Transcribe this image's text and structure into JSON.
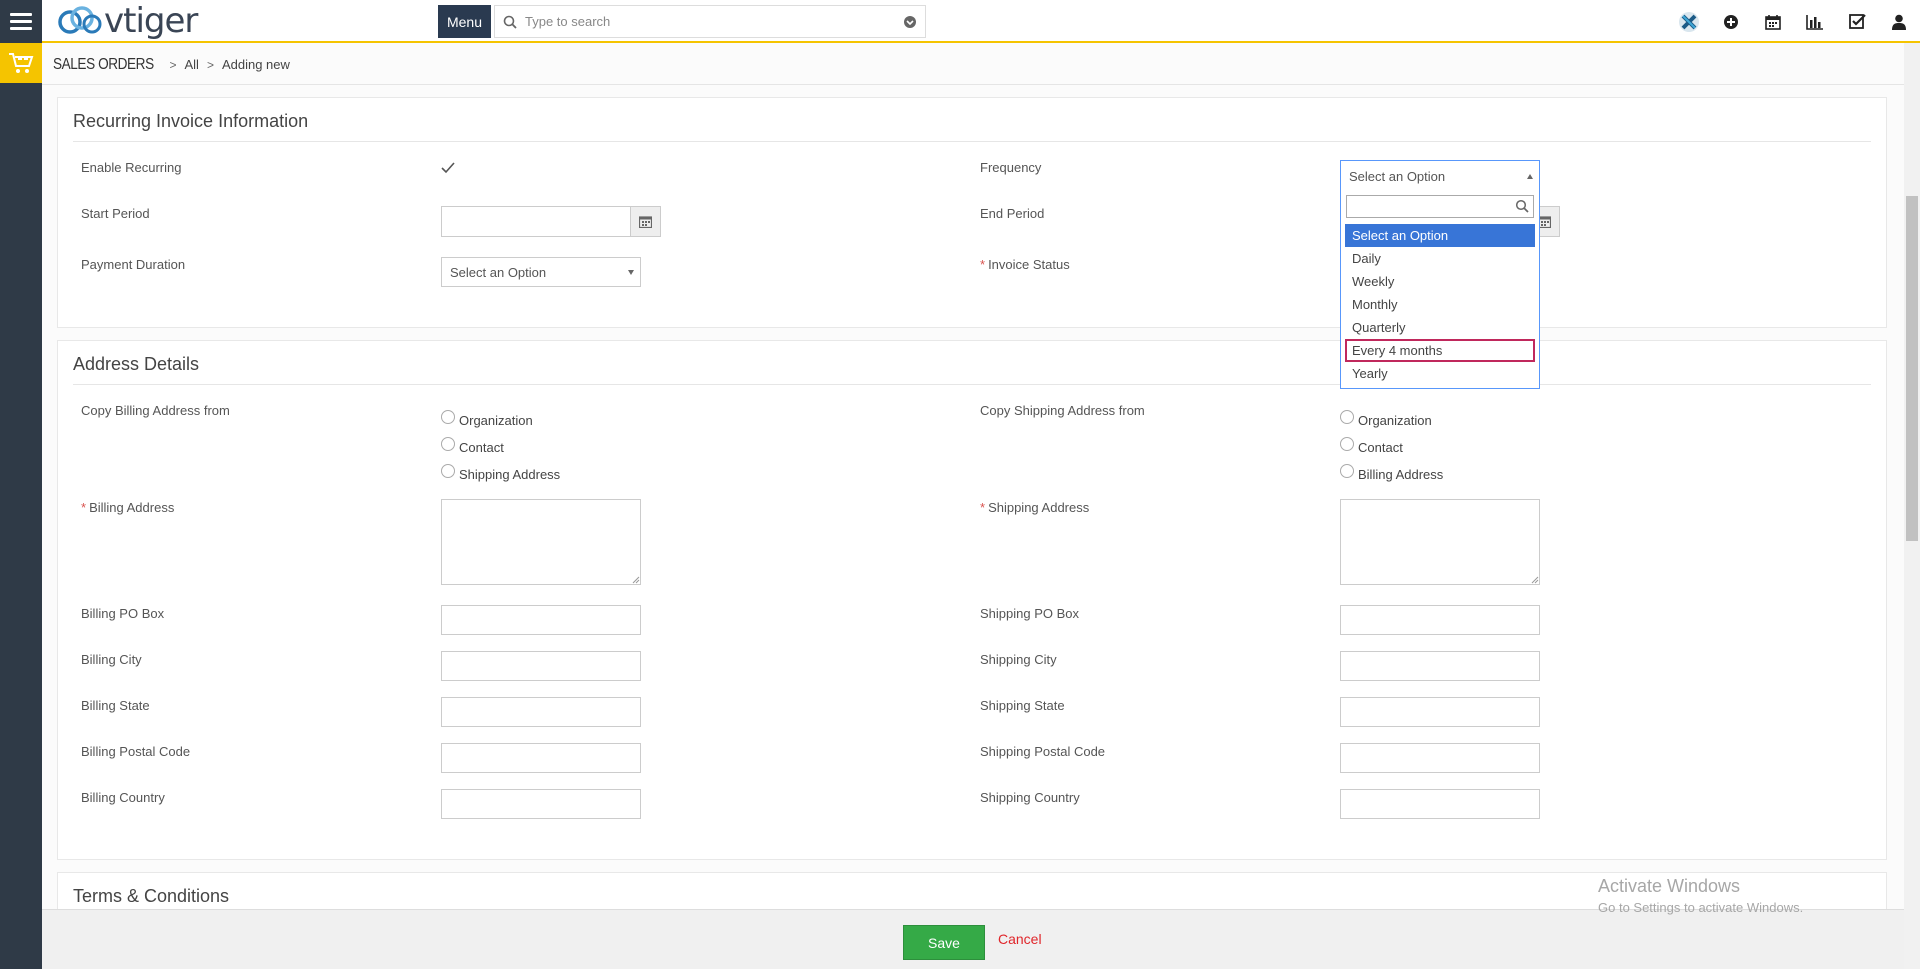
{
  "header": {
    "logo_text": "vtiger",
    "menu_label": "Menu",
    "search_placeholder": "Type to search"
  },
  "breadcrumb": {
    "module": "SALES ORDERS",
    "items": [
      "All",
      "Adding new"
    ]
  },
  "recurring": {
    "title": "Recurring Invoice Information",
    "enable_label": "Enable Recurring",
    "enable_checked": true,
    "frequency_label": "Frequency",
    "frequency_value": "Select an Option",
    "start_label": "Start Period",
    "end_label": "End Period",
    "payment_label": "Payment Duration",
    "payment_value": "Select an Option",
    "status_label": "Invoice Status",
    "frequency_options": [
      "Select an Option",
      "Daily",
      "Weekly",
      "Monthly",
      "Quarterly",
      "Every 4 months",
      "Yearly"
    ]
  },
  "address": {
    "title": "Address Details",
    "copy_billing_label": "Copy Billing Address from",
    "copy_billing_options": [
      "Organization",
      "Contact",
      "Shipping Address"
    ],
    "copy_shipping_label": "Copy Shipping Address from",
    "copy_shipping_options": [
      "Organization",
      "Contact",
      "Billing Address"
    ],
    "billing_address_label": "Billing Address",
    "shipping_address_label": "Shipping Address",
    "billing_pobox_label": "Billing PO Box",
    "shipping_pobox_label": "Shipping PO Box",
    "billing_city_label": "Billing City",
    "shipping_city_label": "Shipping City",
    "billing_state_label": "Billing State",
    "shipping_state_label": "Shipping State",
    "billing_postal_label": "Billing Postal Code",
    "shipping_postal_label": "Shipping Postal Code",
    "billing_country_label": "Billing Country",
    "shipping_country_label": "Shipping Country"
  },
  "terms": {
    "title": "Terms & Conditions"
  },
  "footer": {
    "save_label": "Save",
    "cancel_label": "Cancel"
  },
  "watermark": {
    "line1": "Activate Windows",
    "line2": "Go to Settings to activate Windows."
  },
  "colors": {
    "accent_yellow": "#f5c400",
    "sidebar_dark": "#2f3a47",
    "save_green": "#35aa47",
    "cancel_red": "#e0262b",
    "highlight_blue": "#3875d7",
    "hover_border": "#c0285c"
  }
}
